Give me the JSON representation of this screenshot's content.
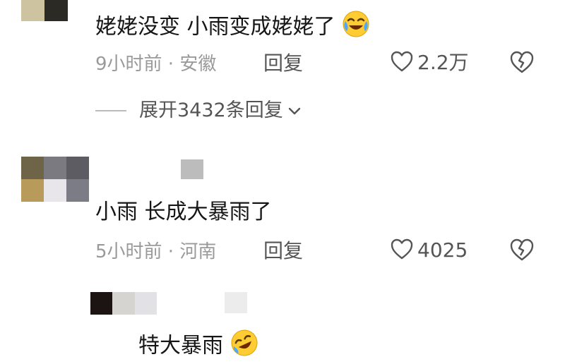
{
  "comments": [
    {
      "text": "姥姥没变  小雨变成姥姥了",
      "emoji": "crying-laughing-emoji",
      "time": "9小时前 · 安徽",
      "reply_label": "回复",
      "likes": "2.2万",
      "expand_label": "展开3432条回复"
    },
    {
      "text": "小雨  长成大暴雨了",
      "time": "5小时前 · 河南",
      "reply_label": "回复",
      "likes": "4025"
    }
  ],
  "reply": {
    "text": "特大暴雨",
    "emoji": "rolling-laughing-emoji"
  },
  "colors": {
    "text": "#161616",
    "meta": "#9a9a9a",
    "action": "#555555"
  }
}
